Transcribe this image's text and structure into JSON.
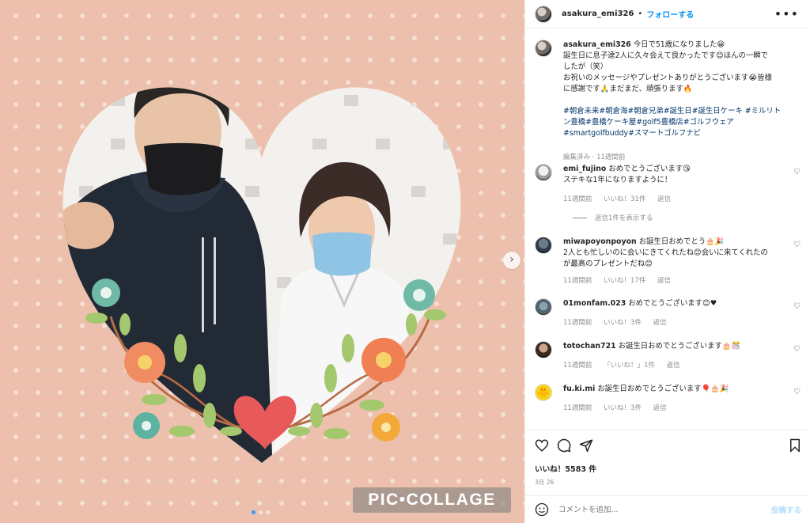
{
  "photo": {
    "watermark": "PIC•COLLAGE",
    "carousel_dots": 3,
    "active_dot": 0,
    "next_icon": "chevron-right-icon"
  },
  "header": {
    "username": "asakura_emi326",
    "separator": "•",
    "follow_label": "フォローする",
    "more_icon": "ellipsis-icon"
  },
  "caption": {
    "username": "asakura_emi326",
    "lines": [
      "今日で51歳になりました😀",
      "誕生日に息子達2人に久々会えて良かったです😊ほんの一瞬で",
      "したが（笑）",
      "お祝いのメッセージやプレゼントありがとうございます😭皆様",
      "に感謝です🙏まだまだ、頑張ります🔥"
    ],
    "hashtags": [
      "#朝倉未来#朝倉海#朝倉兄弟#誕生日#誕生日ケーキ #ミルリト",
      "ン豊橋#豊橋ケーキ屋#golf5豊橋店#ゴルフウェア",
      "#smartgolfbuddy#スマートゴルフナビ"
    ],
    "meta": "編集済み · 11週間前"
  },
  "comments": [
    {
      "username": "emi_fujino",
      "text": "おめでとうございます😘",
      "text2": "ステキな1年になりますように！",
      "time": "11週間前",
      "likes": "いいね！31件",
      "reply": "返信",
      "view_replies": "返信1件を表示する"
    },
    {
      "username": "miwapoyonpoyon",
      "text": "お誕生日おめでとう🎂🎉",
      "text2": "2人とも忙しいのに会いにきてくれたね😊会いに来てくれたの",
      "text3": "が最高のプレゼントだね😊",
      "time": "11週間前",
      "likes": "いいね！17件",
      "reply": "返信"
    },
    {
      "username": "01monfam.023",
      "text": "おめでとうございます😊♥",
      "time": "11週間前",
      "likes": "いいね！3件",
      "reply": "返信"
    },
    {
      "username": "totochan721",
      "text": "お誕生日おめでとうございます🎂🎊",
      "time": "11週間前",
      "likes": "「いいね！」1件",
      "reply": "返信"
    },
    {
      "username": "fu.ki.mi",
      "text": "お誕生日おめでとうございます🎈🎂🎉",
      "time": "11週間前",
      "likes": "いいね！3件",
      "reply": "返信"
    }
  ],
  "actions": {
    "like_icon": "heart-outline-icon",
    "comment_icon": "comment-icon",
    "share_icon": "paper-plane-icon",
    "save_icon": "bookmark-icon",
    "likes_text": "いいね！5583 件",
    "date": "3月 26"
  },
  "add_comment": {
    "emoji_icon": "smiley-icon",
    "placeholder": "コメントを追加...",
    "post_label": "投稿する"
  },
  "colors": {
    "accent": "#0095f6",
    "background_pink": "#ecc0ad",
    "heart_red": "#e8595a"
  }
}
